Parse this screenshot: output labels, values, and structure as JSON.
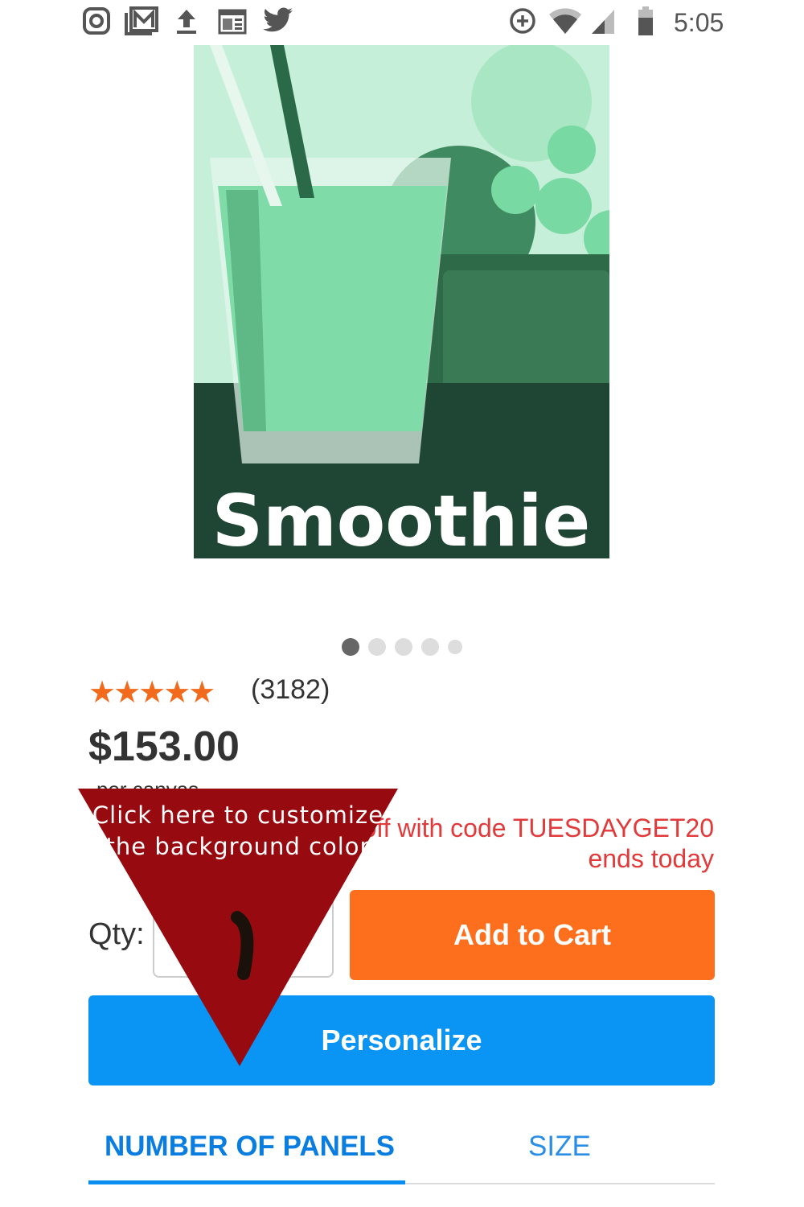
{
  "status_bar": {
    "left_icons": [
      "instagram-icon",
      "gmail-icon",
      "upload-icon",
      "calendar-icon",
      "twitter-icon"
    ],
    "right_icons": [
      "data-saver-icon",
      "wifi-icon",
      "signal-icon",
      "battery-icon"
    ],
    "time": "5:05"
  },
  "product": {
    "image_title": "Smoothie",
    "carousel": {
      "count": 5,
      "active": 0
    },
    "rating": {
      "stars": 5,
      "max": 5,
      "reviews": "(3182)"
    },
    "price": "$153.00",
    "price_unit": "per canvas",
    "promo_line1": "off with code TUESDAYGET20",
    "promo_line2": "ends today"
  },
  "actions": {
    "qty_label": "Qty:",
    "qty_value": "1",
    "add_to_cart": "Add to Cart",
    "personalize": "Personalize"
  },
  "tooltip": {
    "text": "Click here to customize the background color",
    "color": "#970a10"
  },
  "tabs": [
    {
      "label": "NUMBER OF PANELS",
      "active": true
    },
    {
      "label": "SIZE",
      "active": false
    }
  ],
  "colors": {
    "orange": "#fd6f1c",
    "blue": "#0a94f3",
    "promo": "#e23a3a",
    "star": "#f26b1d"
  }
}
